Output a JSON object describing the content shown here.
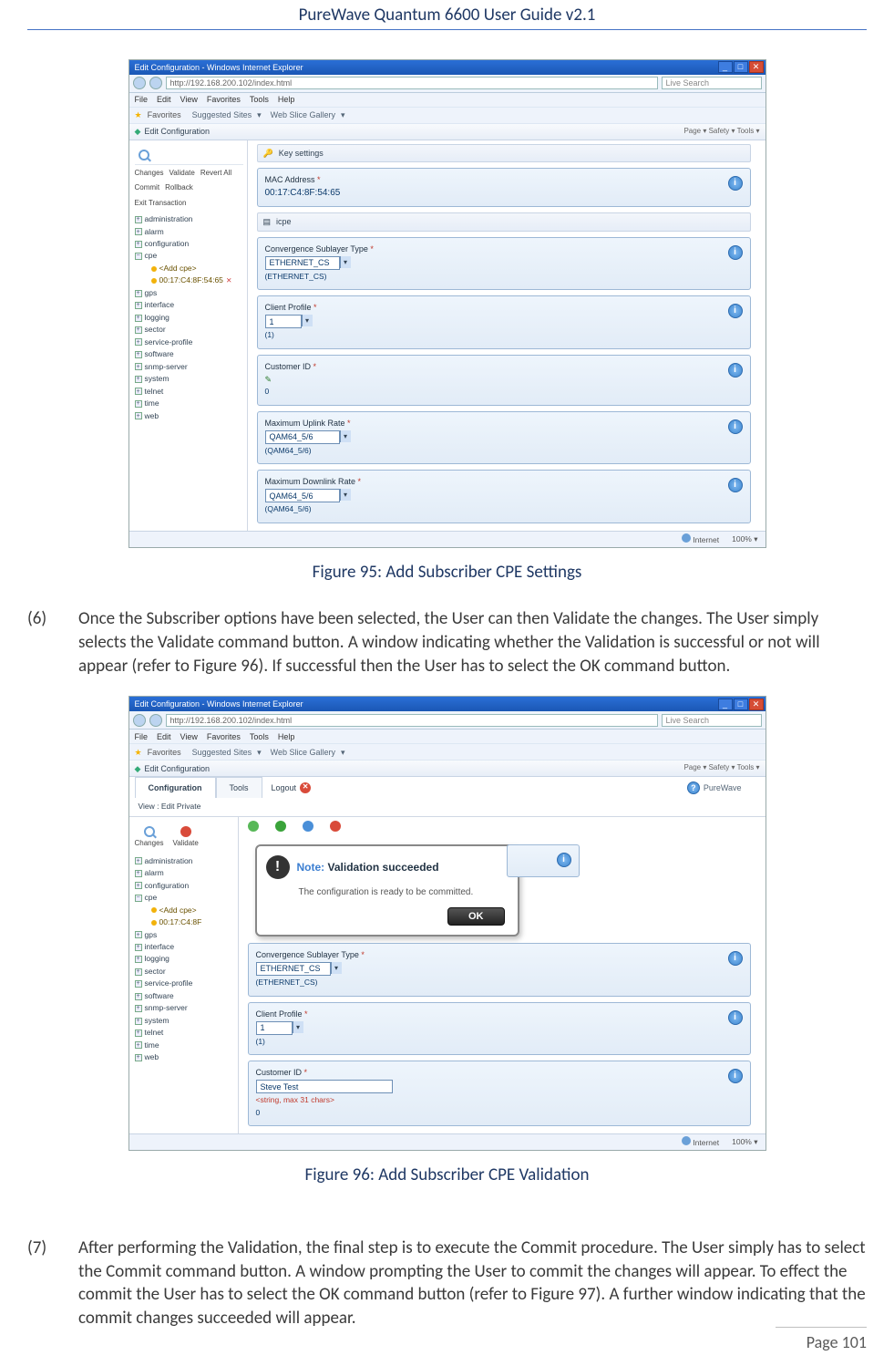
{
  "doc": {
    "header_title": "PureWave Quantum 6600 User Guide v2.1",
    "page_label": "Page 101"
  },
  "captions": {
    "fig95": "Figure 95: Add Subscriber CPE Settings",
    "fig96": "Figure 96: Add Subscriber CPE Validation"
  },
  "paragraphs": {
    "p6_num": "(6)",
    "p6_text": "Once the Subscriber options have been selected, the User can then Validate the changes. The User simply selects the Validate command button. A window indicating whether the Validation is successful or not will appear (refer to Figure 96). If successful then the User has to select the OK command button.",
    "p7_num": "(7)",
    "p7_text": "After performing the Validation, the final step is to execute the Commit procedure. The User simply has to select the Commit command button. A window prompting the User to commit the changes will appear. To effect the commit the User has to select the OK command button (refer to Figure 97). A further window indicating that the commit changes succeeded will appear."
  },
  "shot1": {
    "win_title": "Edit Configuration - Windows Internet Explorer",
    "addr": "http://192.168.200.102/index.html",
    "search_hint": "Live Search",
    "menu": {
      "file": "File",
      "edit": "Edit",
      "view": "View",
      "fav": "Favorites",
      "tools": "Tools",
      "help": "Help"
    },
    "fav_bar": {
      "label": "Favorites",
      "suggested": "Suggested Sites",
      "gallery": "Web Slice Gallery"
    },
    "tab_label": "Edit Configuration",
    "page_tools": "Page ▾   Safety ▾   Tools ▾",
    "toolbar": {
      "changes": "Changes",
      "validate": "Validate",
      "revert": "Revert All",
      "commit": "Commit",
      "rollback": "Rollback",
      "exit": "Exit Transaction"
    },
    "tree": {
      "admin": "administration",
      "alarm": "alarm",
      "config": "configuration",
      "cpe": "cpe",
      "add_cpe": "<Add cpe>",
      "mac_node": "00:17:C4:8F:54:65",
      "gps": "gps",
      "interface": "interface",
      "logging": "logging",
      "sector": "sector",
      "svcprof": "service-profile",
      "software": "software",
      "snmp": "snmp-server",
      "system": "system",
      "telnet": "telnet",
      "time": "time",
      "web": "web"
    },
    "sections": {
      "key": "Key settings",
      "icpe": "icpe"
    },
    "fields": {
      "mac_label": "MAC Address",
      "mac_value": "00:17:C4:8F:54:65",
      "cs_label": "Convergence Sublayer Type",
      "cs_value": "ETHERNET_CS",
      "cs_sub": "(ETHERNET_CS)",
      "prof_label": "Client Profile",
      "prof_value": "1",
      "prof_sub": "(1)",
      "cust_label": "Customer ID",
      "cust_sub": "0",
      "up_label": "Maximum Uplink Rate",
      "up_value": "QAM64_5/6",
      "up_sub": "(QAM64_5/6)",
      "dn_label": "Maximum Downlink Rate",
      "dn_value": "QAM64_5/6",
      "dn_sub": "(QAM64_5/6)"
    },
    "status": {
      "zone": "Internet",
      "zoom": "100%",
      "protect": ""
    }
  },
  "shot2": {
    "win_title": "Edit Configuration - Windows Internet Explorer",
    "addr": "http://192.168.200.102/index.html",
    "search_hint": "Live Search",
    "menu": {
      "file": "File",
      "edit": "Edit",
      "view": "View",
      "fav": "Favorites",
      "tools": "Tools",
      "help": "Help"
    },
    "fav_bar": {
      "label": "Favorites",
      "suggested": "Suggested Sites",
      "gallery": "Web Slice Gallery"
    },
    "tab_label": "Edit Configuration",
    "page_tools": "Page ▾   Safety ▾   Tools ▾",
    "top": {
      "config": "Configuration",
      "tools": "Tools",
      "logout": "Logout",
      "brand": "PureWave",
      "help": "?"
    },
    "breadcrumb": "View : Edit Private",
    "toolbar": {
      "changes": "Changes",
      "validate": "Validate"
    },
    "tree": {
      "admin": "administration",
      "alarm": "alarm",
      "config": "configuration",
      "cpe": "cpe",
      "add_cpe": "<Add cpe>",
      "mac_node": "00:17:C4:8F",
      "gps": "gps",
      "interface": "interface",
      "logging": "logging",
      "sector": "sector",
      "svcprof": "service-profile",
      "software": "software",
      "snmp": "snmp-server",
      "system": "system",
      "telnet": "telnet",
      "time": "time",
      "web": "web"
    },
    "dialog": {
      "note_label": "Note:",
      "title": "Validation succeeded",
      "body": "The configuration is ready to be committed.",
      "ok": "OK"
    },
    "fields": {
      "cs_label": "Convergence Sublayer Type",
      "cs_value": "ETHERNET_CS",
      "cs_sub": "(ETHERNET_CS)",
      "prof_label": "Client Profile",
      "prof_value": "1",
      "prof_sub": "(1)",
      "cust_label": "Customer ID",
      "cust_value": "Steve Test",
      "cust_hint": "<string, max 31 chars>",
      "cust_sub": "0"
    },
    "status": {
      "zone": "Internet",
      "zoom": "100%"
    }
  }
}
